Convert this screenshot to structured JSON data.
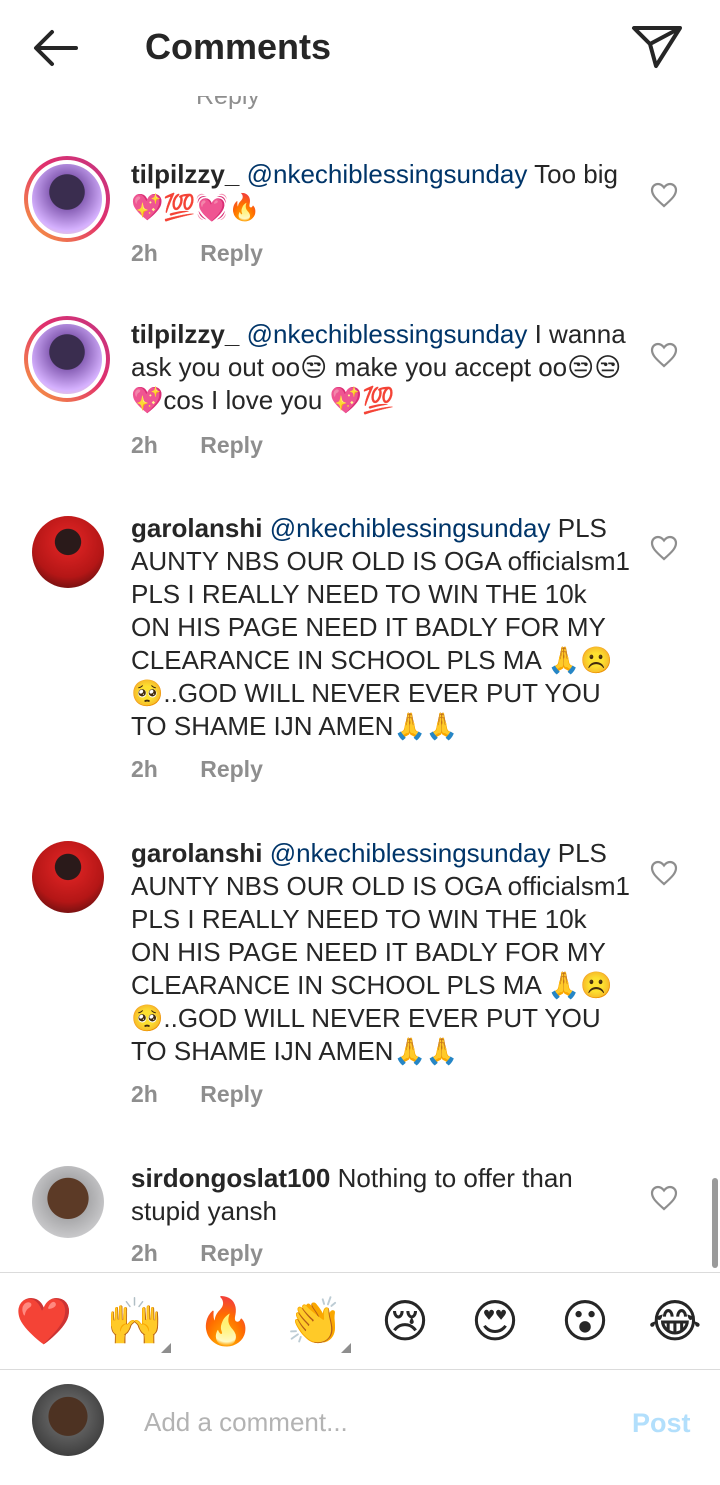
{
  "header": {
    "title": "Comments"
  },
  "top_cut_text": "Reply",
  "comments": [
    {
      "username": "tilpilzzy_",
      "mention": "@nkechiblessingsunday",
      "text": " Too big💖💯💓🔥",
      "time": "2h",
      "reply": "Reply"
    },
    {
      "username": "tilpilzzy_",
      "mention": "@nkechiblessingsunday",
      "text": " I wanna ask you out oo😒 make you accept oo😒😒💖cos I love you 💖💯",
      "time": "2h",
      "reply": "Reply"
    },
    {
      "username": "garolanshi",
      "mention": "@nkechiblessingsunday",
      "text": " PLS AUNTY NBS OUR OLD IS OGA officialsm1 PLS I REALLY NEED TO WIN THE 10k ON HIS PAGE NEED IT BADLY FOR MY CLEARANCE IN SCHOOL PLS MA 🙏☹️🥺..GOD WILL NEVER EVER PUT YOU TO SHAME IJN AMEN🙏🙏",
      "time": "2h",
      "reply": "Reply"
    },
    {
      "username": "garolanshi",
      "mention": "@nkechiblessingsunday",
      "text": " PLS AUNTY NBS OUR OLD IS OGA officialsm1 PLS I REALLY NEED TO WIN THE 10k ON HIS PAGE NEED IT BADLY FOR MY CLEARANCE IN SCHOOL PLS MA 🙏☹️🥺..GOD WILL NEVER EVER PUT YOU TO SHAME IJN AMEN🙏🙏",
      "time": "2h",
      "reply": "Reply"
    },
    {
      "username": "sirdongoslat100",
      "mention": "",
      "text": " Nothing to offer than stupid yansh",
      "time": "2h",
      "reply": "Reply"
    }
  ],
  "emoji_bar": [
    "❤️",
    "🙌",
    "🔥",
    "👏",
    "😢",
    "😍",
    "😮",
    "😂"
  ],
  "composer": {
    "placeholder": "Add a comment...",
    "post_label": "Post"
  },
  "colors": {
    "post": "#b2dffc",
    "mention": "#003569",
    "muted": "#8e8e8e"
  }
}
